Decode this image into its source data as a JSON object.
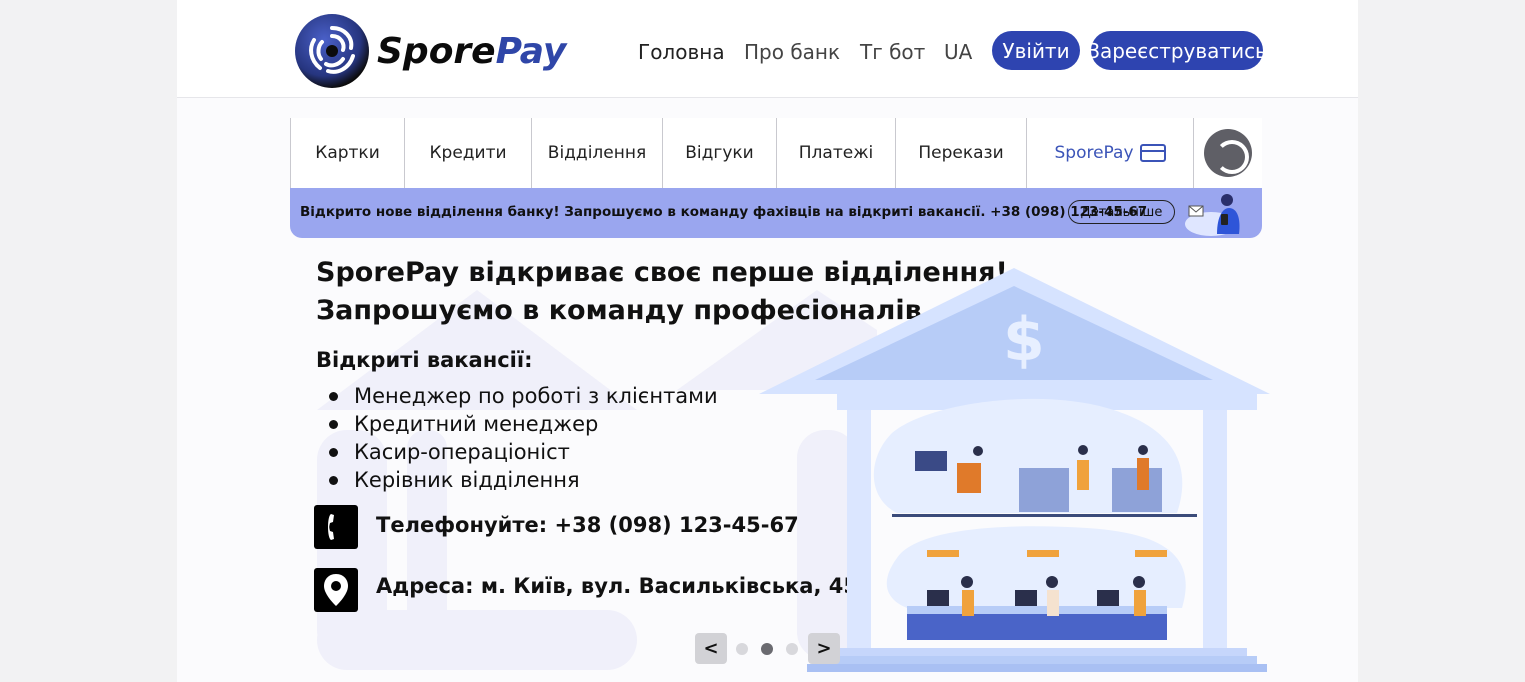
{
  "brand": {
    "part1": "Spore",
    "part2": "Pay"
  },
  "topnav": {
    "home": "Головна",
    "about": "Про банк",
    "bot": "Тг бот",
    "lang": "UA",
    "login": "Увійти",
    "register": "Зареєструватись"
  },
  "menu": {
    "items": [
      "Картки",
      "Кредити",
      "Відділення",
      "Відгуки",
      "Платежі",
      "Перекази"
    ],
    "sporepay": "SporePay"
  },
  "banner": {
    "text": "Відкрито нове відділення банку! Запрошуємо в команду фахівців на відкриті вакансії. +38 (098) 123-45-67",
    "button": "Детальніше"
  },
  "hero": {
    "line1": "SporePay відкриває своє перше відділення!",
    "line2": "Запрошуємо в команду професіоналів.",
    "vacancies_title": "Відкриті вакансії:",
    "vacancies": [
      "Менеджер по роботі з клієнтами",
      "Кредитний менеджер",
      "Касир-операціоніст",
      "Керівник відділення"
    ],
    "phone": "Телефонуйте: +38 (098) 123-45-67",
    "address": "Адреса: м. Київ, вул. Васильківська, 45"
  },
  "slider": {
    "prev": "<",
    "next": ">",
    "slides": 3,
    "active_index": 1
  },
  "colors": {
    "accent": "#2e44b0",
    "banner": "#9aa6ef",
    "link": "#3b54b8"
  }
}
